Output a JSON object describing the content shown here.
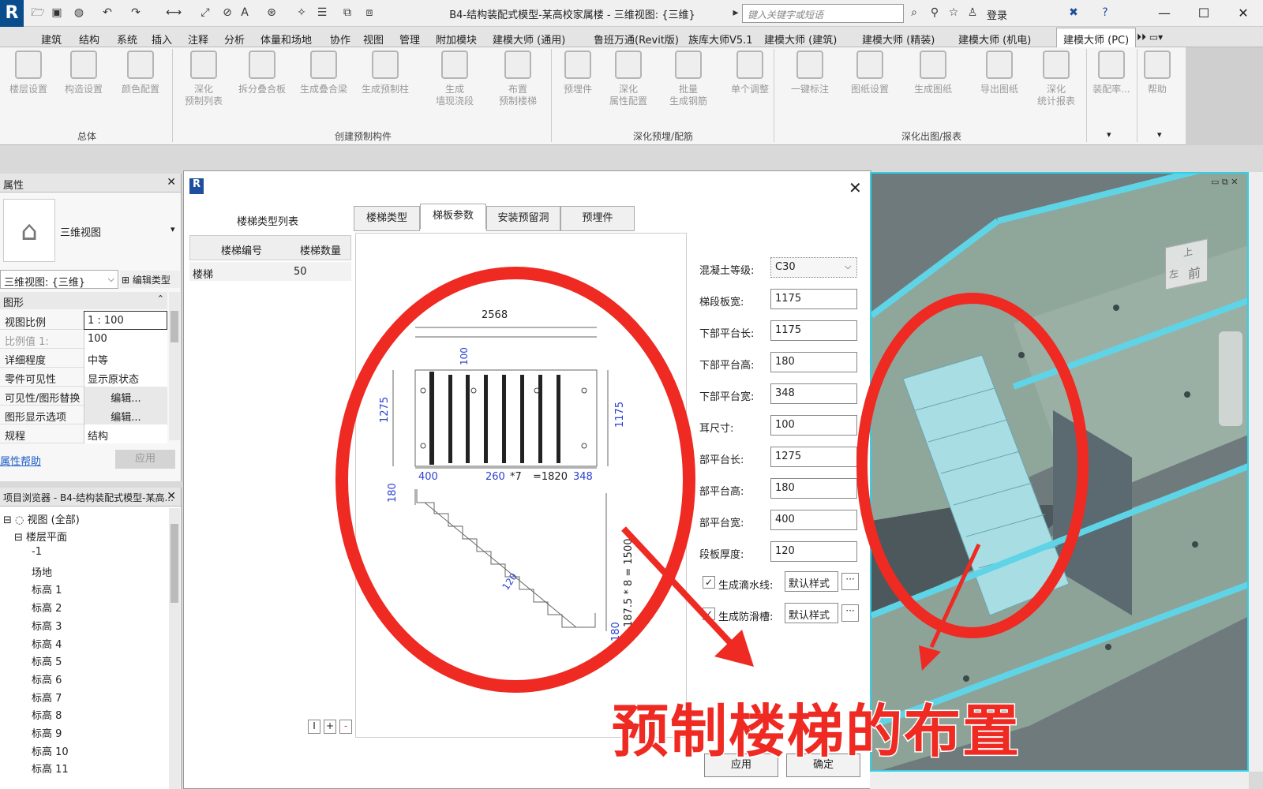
{
  "titlebar": {
    "title": "B4-结构装配式模型-某高校家属楼 - 三维视图: {三维}",
    "search_placeholder": "键入关键字或短语",
    "login": "登录"
  },
  "menu": [
    "建筑",
    "结构",
    "系统",
    "插入",
    "注释",
    "分析",
    "体量和场地",
    "协作",
    "视图",
    "管理",
    "附加模块",
    "建模大师 (通用)",
    "鲁班万通(Revit版)",
    "族库大师V5.1",
    "建模大师 (建筑)",
    "建模大师 (精装)",
    "建模大师 (机电)",
    "建模大师 (PC)"
  ],
  "ribbon": {
    "buttons": [
      "楼层设置",
      "构造设置",
      "颜色配置",
      "深化\n预制列表",
      "拆分叠合板",
      "生成叠合梁",
      "生成预制柱",
      "生成\n墙现浇段",
      "布置\n预制楼梯",
      "预埋件",
      "深化\n属性配置",
      "批量\n生成钢筋",
      "单个调整",
      "一键标注",
      "图纸设置",
      "生成图纸",
      "导出图纸",
      "深化\n统计报表",
      "装配率...",
      "帮助"
    ],
    "groups": [
      "总体",
      "创建预制构件",
      "深化预埋/配筋",
      "深化出图/报表"
    ]
  },
  "properties": {
    "title": "属性",
    "type_name": "三维视图",
    "view_selector": "三维视图: {三维}",
    "edit_type": "编辑类型",
    "section": "图形",
    "rows": [
      {
        "k": "视图比例",
        "v": "1 : 100"
      },
      {
        "k": "比例值 1:",
        "v": "100"
      },
      {
        "k": "详细程度",
        "v": "中等"
      },
      {
        "k": "零件可见性",
        "v": "显示原状态"
      },
      {
        "k": "可见性/图形替换",
        "v": "编辑..."
      },
      {
        "k": "图形显示选项",
        "v": "编辑..."
      },
      {
        "k": "规程",
        "v": "结构"
      }
    ],
    "help": "属性帮助",
    "apply": "应用"
  },
  "browser": {
    "title": "项目浏览器 - B4-结构装配式模型-某高...",
    "root": "视图 (全部)",
    "group": "楼层平面",
    "items": [
      "-1",
      "场地",
      "标高 1",
      "标高 2",
      "标高 3",
      "标高 4",
      "标高 5",
      "标高 6",
      "标高 7",
      "标高 8",
      "标高 9",
      "标高 10",
      "标高 11"
    ]
  },
  "dialog": {
    "list_title": "楼梯类型列表",
    "col1": "楼梯编号",
    "col2": "楼梯数量",
    "row_name": "楼梯",
    "row_count": "50",
    "tabs": [
      "楼梯类型",
      "梯板参数",
      "安装预留洞",
      "预埋件"
    ],
    "drawing": {
      "top_width": "2568",
      "dim_100": "100",
      "left_h": "1275",
      "right_h": "1175",
      "b1": "400",
      "b2": "260",
      "b3": "*7",
      "b4": "=1820",
      "b5": "348",
      "s_180a": "180",
      "s_slope": "120",
      "s_total": "187.5 * 8 = 1500",
      "s_180b": "180"
    },
    "fields": [
      {
        "label": "混凝土等级:",
        "value": "C30",
        "select": true
      },
      {
        "label": "梯段板宽:",
        "value": "1175"
      },
      {
        "label": "下部平台长:",
        "value": "1175"
      },
      {
        "label": "下部平台高:",
        "value": "180"
      },
      {
        "label": "下部平台宽:",
        "value": "348"
      },
      {
        "label": "耳尺寸:",
        "value": "100"
      },
      {
        "label": "部平台长:",
        "value": "1275"
      },
      {
        "label": "部平台高:",
        "value": "180"
      },
      {
        "label": "部平台宽:",
        "value": "400"
      },
      {
        "label": "段板厚度:",
        "value": "120"
      }
    ],
    "check1": "生成滴水线:",
    "check1_val": "默认样式",
    "check2": "生成防滑槽:",
    "check2_val": "默认样式",
    "apply": "应用",
    "ok": "确定",
    "small_btns": [
      "I",
      "+",
      "-"
    ]
  },
  "viewcube": {
    "top": "上",
    "front": "前",
    "left": "左"
  },
  "caption": "预制楼梯的布置",
  "colors": {
    "accent": "#ee2a22",
    "viewport_border": "#32d0e8",
    "slab": "#8fa69a",
    "stair": "#a8dde4"
  }
}
